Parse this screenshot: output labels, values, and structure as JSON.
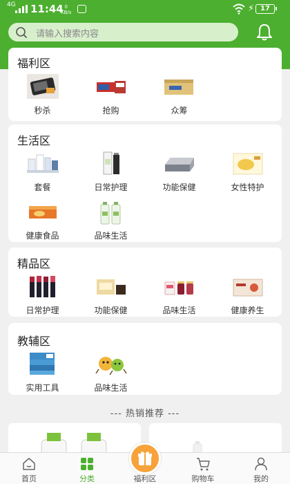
{
  "status_bar": {
    "signal": "4G",
    "time": "11:44",
    "speed_value": "0",
    "speed_unit": "KB/s",
    "battery": "17"
  },
  "search": {
    "placeholder": "请输入搜索内容"
  },
  "sections": {
    "welfare": {
      "title": "福利区",
      "items": [
        {
          "label": "秒杀",
          "icon": "phone-product-image"
        },
        {
          "label": "抢购",
          "icon": "box-product-image"
        },
        {
          "label": "众筹",
          "icon": "package-product-image"
        }
      ]
    },
    "life": {
      "title": "生活区",
      "items": [
        {
          "label": "套餐",
          "icon": "combo-set-image"
        },
        {
          "label": "日常护理",
          "icon": "skincare-bottle-image"
        },
        {
          "label": "功能保健",
          "icon": "mattress-image"
        },
        {
          "label": "女性特护",
          "icon": "sanitary-pad-image"
        },
        {
          "label": "健康食品",
          "icon": "food-box-image"
        },
        {
          "label": "品味生活",
          "icon": "bottles-image"
        }
      ]
    },
    "premium": {
      "title": "精品区",
      "items": [
        {
          "label": "日常护理",
          "icon": "lipstick-image"
        },
        {
          "label": "功能保健",
          "icon": "health-box-image"
        },
        {
          "label": "品味生活",
          "icon": "jar-set-image"
        },
        {
          "label": "健康养生",
          "icon": "gift-box-image"
        }
      ]
    },
    "tutor": {
      "title": "教辅区",
      "items": [
        {
          "label": "实用工具",
          "icon": "books-image"
        },
        {
          "label": "品味生活",
          "icon": "cartoon-fruit-image"
        }
      ]
    }
  },
  "hot": {
    "title": "--- 热销推荐 ---"
  },
  "tabbar": {
    "items": [
      {
        "label": "首页",
        "icon": "home-icon"
      },
      {
        "label": "分类",
        "icon": "category-icon"
      },
      {
        "label": "福利区",
        "icon": "gift-icon"
      },
      {
        "label": "购物车",
        "icon": "cart-icon"
      },
      {
        "label": "我的",
        "icon": "user-icon"
      }
    ],
    "active_index": 1
  },
  "colors": {
    "brand": "#4caf2f",
    "tab_center": "#f7a23a"
  }
}
